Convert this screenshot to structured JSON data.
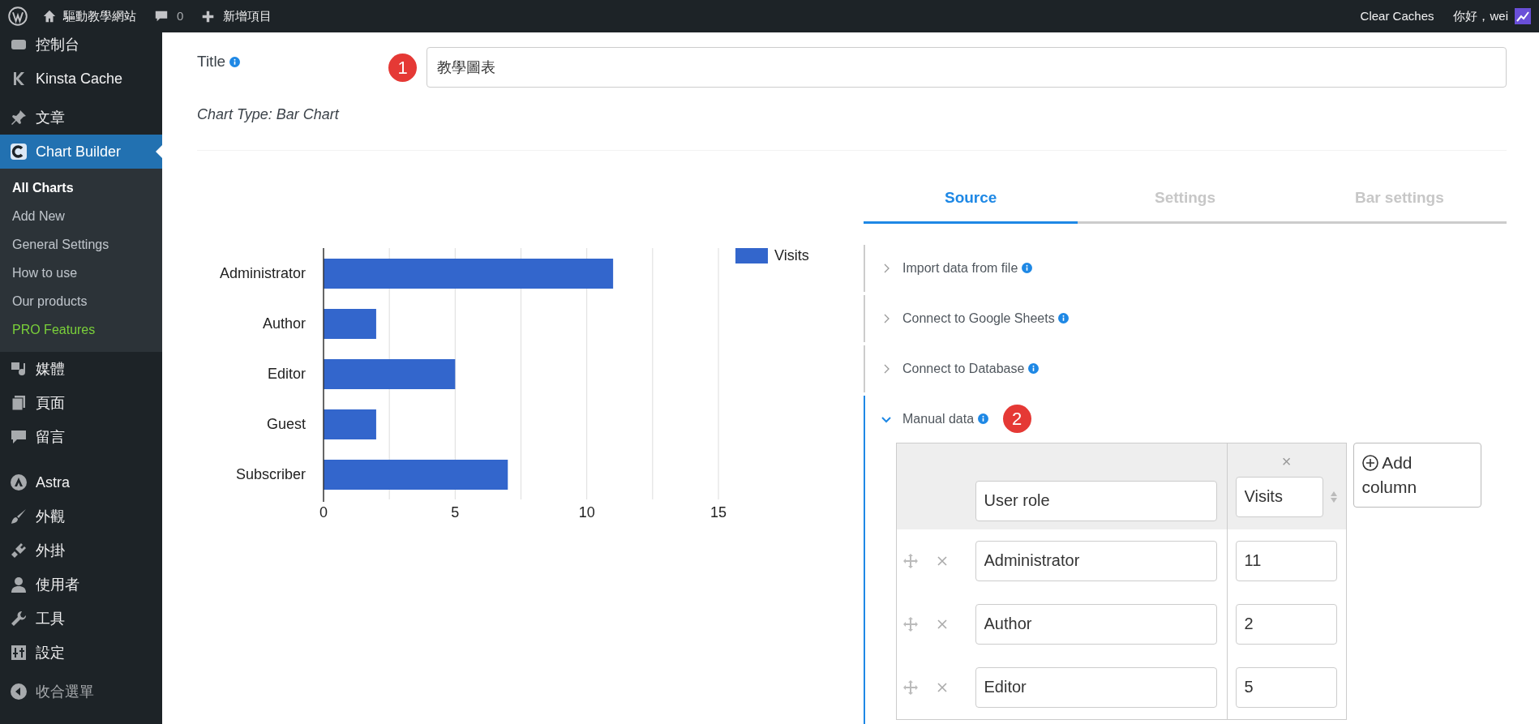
{
  "admin_bar": {
    "site_name": "驅動教學網站",
    "comments": "0",
    "new_item": "新增項目",
    "clear_caches": "Clear Caches",
    "greeting": "你好，wei"
  },
  "sidebar": {
    "items": [
      {
        "label": "控制台",
        "selected": false
      },
      {
        "label": "Kinsta Cache",
        "selected": false
      },
      {
        "label": "文章",
        "selected": false
      },
      {
        "label": "Chart Builder",
        "selected": true,
        "children": [
          {
            "label": "All Charts",
            "selected": true,
            "kind": "link"
          },
          {
            "label": "Add New",
            "selected": false,
            "kind": "link"
          },
          {
            "label": "General Settings",
            "selected": false,
            "kind": "link"
          },
          {
            "label": "How to use",
            "selected": false,
            "kind": "link"
          },
          {
            "label": "Our products",
            "selected": false,
            "kind": "link"
          },
          {
            "label": "PRO Features",
            "selected": false,
            "kind": "pro"
          }
        ]
      },
      {
        "label": "媒體",
        "selected": false
      },
      {
        "label": "頁面",
        "selected": false
      },
      {
        "label": "留言",
        "selected": false
      },
      {
        "label": "Astra",
        "selected": false
      },
      {
        "label": "外觀",
        "selected": false
      },
      {
        "label": "外掛",
        "selected": false
      },
      {
        "label": "使用者",
        "selected": false
      },
      {
        "label": "工具",
        "selected": false
      },
      {
        "label": "設定",
        "selected": false
      },
      {
        "label": "收合選單",
        "selected": false
      }
    ]
  },
  "title_field": {
    "label": "Title",
    "badge": "1",
    "value": "教學圖表"
  },
  "chart_type": "Chart Type: Bar Chart",
  "chart": {
    "chart_data": {
      "type": "bar",
      "orientation": "horizontal",
      "categories": [
        "Administrator",
        "Author",
        "Editor",
        "Guest",
        "Subscriber"
      ],
      "series": [
        {
          "name": "Visits",
          "color": "#3366cc",
          "values": [
            11,
            2,
            5,
            2,
            7
          ]
        }
      ],
      "xlim": [
        0,
        15
      ],
      "xticks": [
        0,
        5,
        10,
        15
      ]
    }
  },
  "tabs": [
    {
      "label": "Source",
      "selected": true
    },
    {
      "label": "Settings",
      "selected": false
    },
    {
      "label": "Bar settings",
      "selected": false
    }
  ],
  "sections": [
    {
      "label": "Import data from file",
      "expanded": false
    },
    {
      "label": "Connect to Google Sheets",
      "expanded": false
    },
    {
      "label": "Connect to Database",
      "expanded": false
    },
    {
      "label": "Manual data",
      "expanded": true,
      "badge": "2"
    }
  ],
  "data_table": {
    "remove_column": "×",
    "columns": [
      "User role",
      "Visits"
    ],
    "rows": [
      [
        "Administrator",
        "11"
      ],
      [
        "Author",
        "2"
      ],
      [
        "Editor",
        "5"
      ]
    ],
    "add_column": "Add column"
  }
}
